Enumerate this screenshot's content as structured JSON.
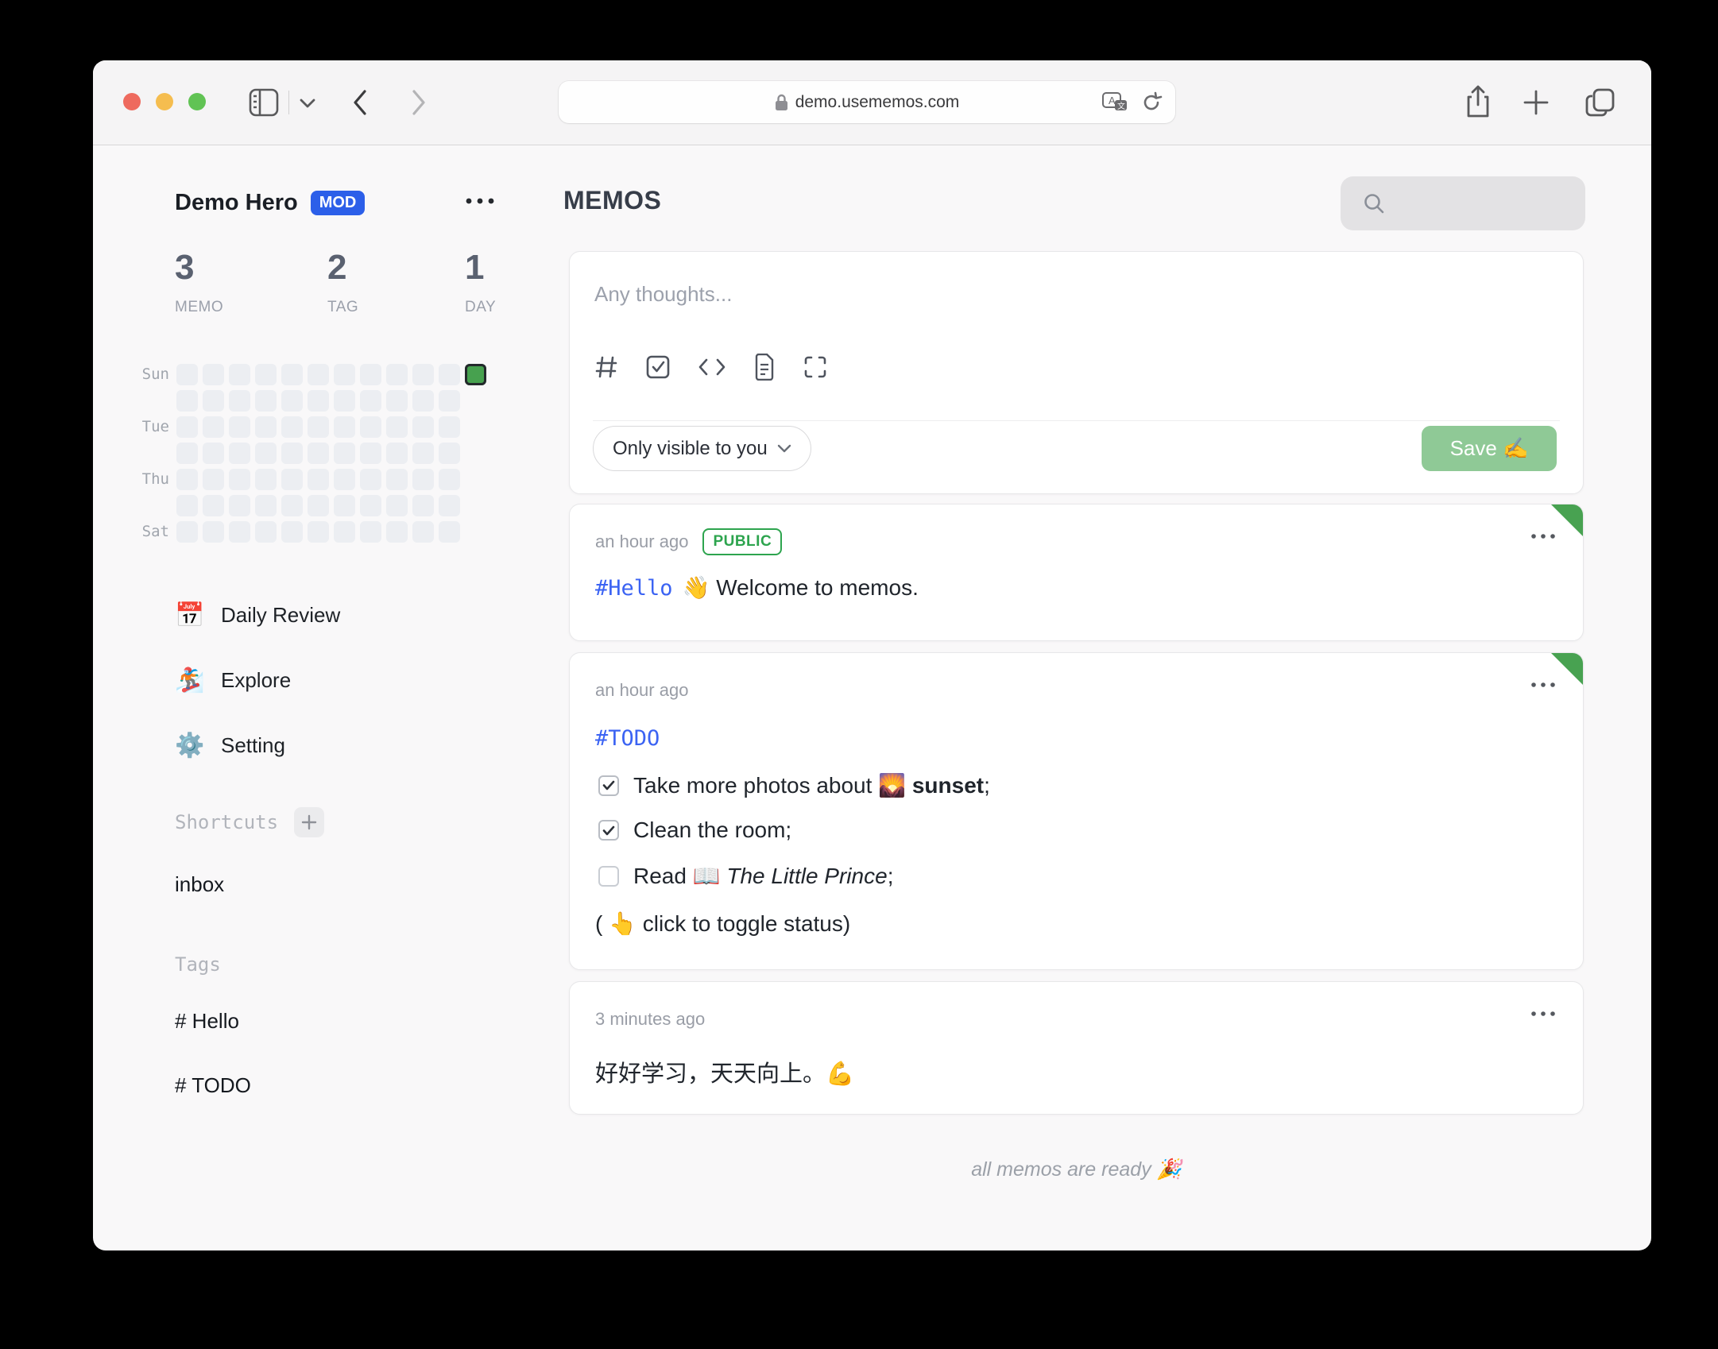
{
  "browser": {
    "url": "demo.usememos.com",
    "icons": [
      "sidebar-toggle",
      "chevron-down",
      "back",
      "forward",
      "lock",
      "translate",
      "reload",
      "share",
      "new-tab",
      "tab-overview"
    ]
  },
  "colors": {
    "accent_blue": "#2c5fe9",
    "tag_blue": "#3b63f3",
    "public_green": "#2da44e",
    "pin_green": "#48a251",
    "heatmap_active_green": "#47a14f",
    "save_green": "#8fc996"
  },
  "sidebar": {
    "profile": {
      "name": "Demo Hero",
      "badge": "MOD"
    },
    "stats": [
      {
        "value": "3",
        "label": "MEMO"
      },
      {
        "value": "2",
        "label": "TAG"
      },
      {
        "value": "1",
        "label": "DAY"
      }
    ],
    "heatmap": {
      "weeks": 12,
      "rows": 7,
      "days_shown_last_week": 1,
      "active_week": 11,
      "active_day": 0,
      "day_labels": [
        "Sun",
        "Tue",
        "Thu",
        "Sat"
      ]
    },
    "nav": [
      {
        "icon": "📅",
        "label": "Daily Review"
      },
      {
        "icon": "🏂",
        "label": "Explore"
      },
      {
        "icon": "⚙️",
        "label": "Setting"
      }
    ],
    "shortcuts_header": "Shortcuts",
    "shortcut_items": [
      "inbox"
    ],
    "tags_header": "Tags",
    "tags": [
      "# Hello",
      "# TODO"
    ]
  },
  "main": {
    "title": "MEMOS",
    "editor": {
      "placeholder": "Any thoughts...",
      "toolbar_icons": [
        "hash",
        "check-square",
        "code",
        "file-text",
        "fullscreen"
      ],
      "visibility": "Only visible to you",
      "save_label": "Save ✍️"
    },
    "memos": [
      {
        "time": "an hour ago",
        "badge": "PUBLIC",
        "tag": "#Hello",
        "text": "👋 Welcome to memos.",
        "pinned": true
      },
      {
        "time": "an hour ago",
        "tag": "#TODO",
        "pinned": true,
        "todos": [
          {
            "checked": true,
            "pre": "Take more photos about 🌄 ",
            "bold": "sunset",
            "post": ";"
          },
          {
            "checked": true,
            "pre": "Clean the room;"
          },
          {
            "checked": false,
            "pre": "Read 📖 ",
            "italic": "The Little Prince",
            "post": ";"
          }
        ],
        "note": "( 👆  click to toggle status)"
      },
      {
        "time": "3 minutes ago",
        "text": "好好学习，天天向上。💪",
        "pinned": false
      }
    ],
    "footer": "all memos are ready 🎉"
  }
}
